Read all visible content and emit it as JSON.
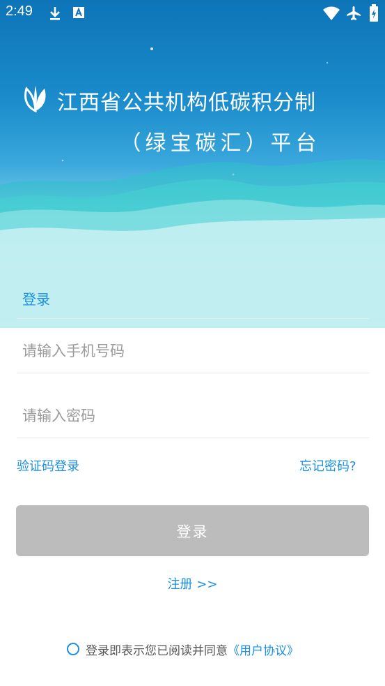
{
  "status_bar": {
    "time": "2:49",
    "icons_left": [
      "download-icon",
      "font-icon"
    ],
    "icons_right": [
      "wifi-icon",
      "airplane-icon",
      "battery-charging-icon"
    ]
  },
  "hero": {
    "logo_icon": "leaf-logo-icon",
    "title_line1": "江西省公共机构低碳积分制",
    "title_line2": "（绿宝碳汇）平台"
  },
  "form": {
    "title": "登录",
    "phone_placeholder": "请输入手机号码",
    "phone_value": "",
    "password_placeholder": "请输入密码",
    "password_value": "",
    "sms_login_label": "验证码登录",
    "forgot_password_label": "忘记密码?",
    "login_button_label": "登录",
    "register_label": "注册 >>"
  },
  "agreement": {
    "checked": false,
    "text": "登录即表示您已阅读并同意",
    "protocol_link": "《用户协议》"
  },
  "colors": {
    "accent": "#1b8fe0",
    "disabled_button": "#bcbcbc",
    "hero_top": "#0d74b8"
  }
}
